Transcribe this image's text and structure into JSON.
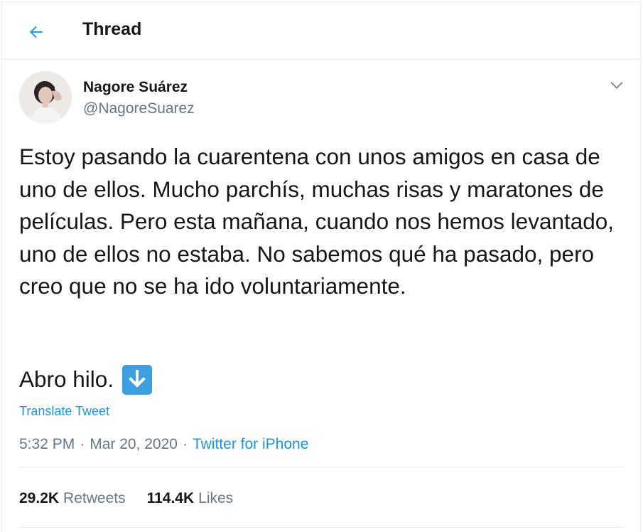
{
  "header": {
    "title": "Thread",
    "back_icon": "arrow-left-icon",
    "accent_color": "#1da1f2"
  },
  "author": {
    "name": "Nagore Suárez",
    "handle": "@NagoreSuarez"
  },
  "tweet": {
    "text": "Estoy pasando la cuarentena con unos amigos en casa de uno de ellos. Mucho parchís, muchas risas y maratones de películas. Pero esta mañana, cuando nos hemos levantado, uno de ellos no estaba. No sabemos qué ha pasado, pero creo que no se ha ido voluntariamente.",
    "line2": "Abro hilo.",
    "emoji_icon": "down-arrow-emoji-icon",
    "translate_label": "Translate Tweet",
    "time": "5:32 PM",
    "date": "Mar 20, 2020",
    "separator": "·",
    "source": "Twitter for iPhone"
  },
  "stats": {
    "retweets_count": "29.2K",
    "retweets_label": "Retweets",
    "likes_count": "114.4K",
    "likes_label": "Likes"
  }
}
